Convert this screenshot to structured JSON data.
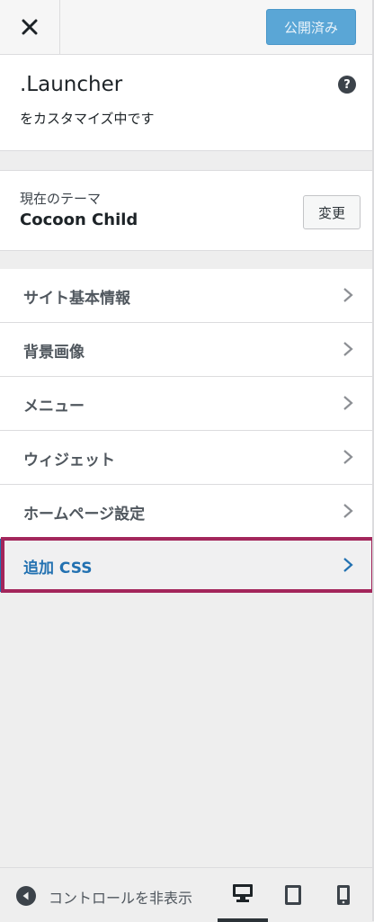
{
  "header": {
    "close_icon": "close-icon",
    "publish_label": "公開済み"
  },
  "info": {
    "site_title": ".Launcher",
    "subtitle": "をカスタマイズ中です",
    "help_icon": "question-circle-icon"
  },
  "theme": {
    "label": "現在のテーマ",
    "name": "Cocoon Child",
    "change_label": "変更"
  },
  "menu": {
    "items": [
      {
        "label": "サイト基本情報"
      },
      {
        "label": "背景画像"
      },
      {
        "label": "メニュー"
      },
      {
        "label": "ウィジェット"
      },
      {
        "label": "ホームページ設定"
      },
      {
        "label": "追加 CSS"
      }
    ],
    "active_index": 5
  },
  "footer": {
    "collapse_label": "コントロールを非表示",
    "devices": [
      "desktop-icon",
      "tablet-icon",
      "mobile-icon"
    ],
    "active_device": "desktop"
  },
  "colors": {
    "accent": "#2271b1",
    "publish_bg": "#5aa6d6",
    "highlight": "#a3265b"
  }
}
